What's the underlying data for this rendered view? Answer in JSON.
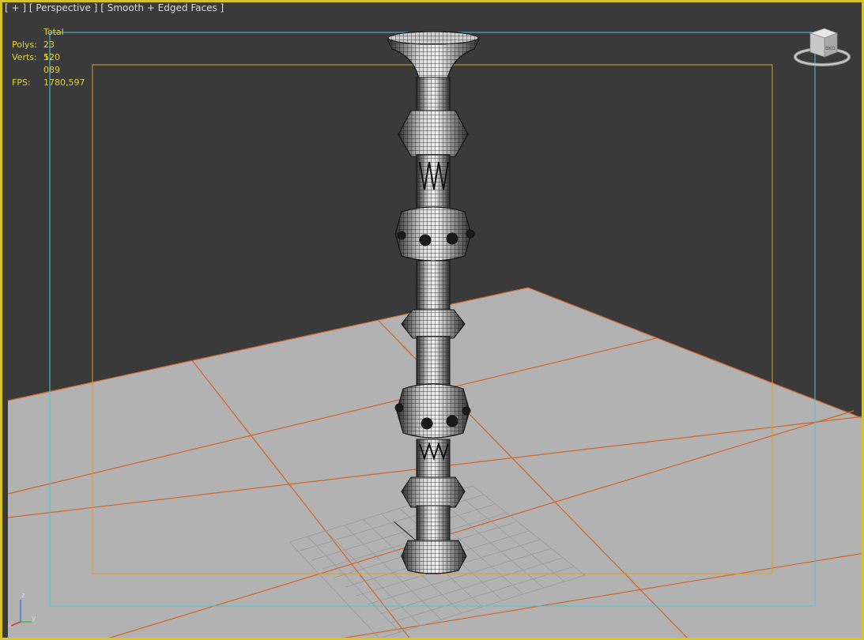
{
  "viewport": {
    "menu_plus": "[ + ]",
    "view_name": "[ Perspective ]",
    "shading_mode": "[ Smooth + Edged Faces ]"
  },
  "stats": {
    "title": "Total",
    "polys_label": "Polys:",
    "polys_value": "23 520",
    "verts_label": "Verts:",
    "verts_value": "12 089",
    "fps_label": "FPS:",
    "fps_value": "1780,597"
  },
  "viewcube": {
    "face_label": "BKG"
  },
  "axis": {
    "x_label": "x",
    "y_label": "y",
    "z_label": "z"
  },
  "colors": {
    "background": "#3a3a3a",
    "floor": "#b2b2b2",
    "floor_lines": "#d0642a",
    "active_border": "#d6c229",
    "safe_frame_outer": "#4fc3d6",
    "safe_frame_inner": "#e0a020",
    "stats_text": "#e2d33a"
  },
  "icons": [
    "viewcube-icon",
    "axis-tripod-icon"
  ]
}
